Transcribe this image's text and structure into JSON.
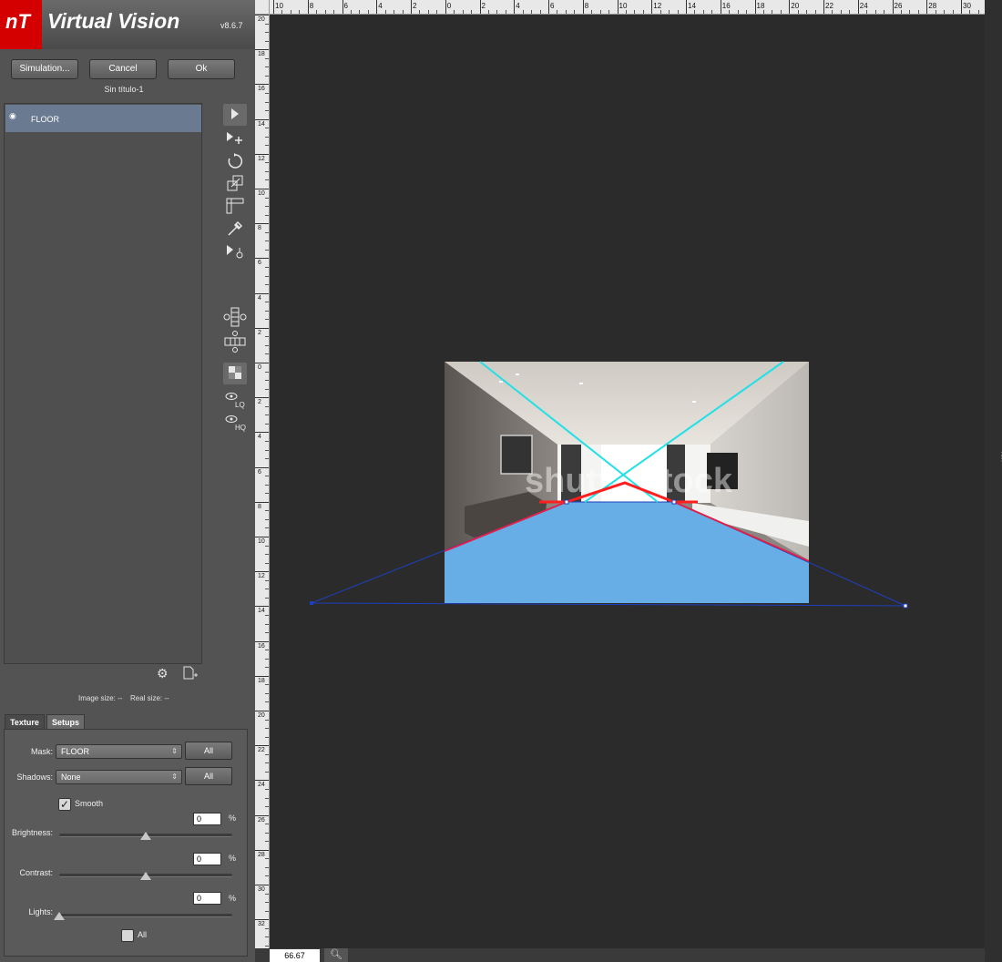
{
  "app": {
    "logo": "nT",
    "title": "Virtual Vision",
    "version": "v8.6.7"
  },
  "toolbar": {
    "simulation_label": "Simulation...",
    "cancel_label": "Cancel",
    "ok_label": "Ok"
  },
  "document": {
    "title": "Sin título-1"
  },
  "layers": [
    {
      "name": "FLOOR",
      "visible": true
    }
  ],
  "info": {
    "image_size": "Image size:  --",
    "real_size": "Real size:  --"
  },
  "tabs": {
    "texture": "Texture",
    "setups": "Setups"
  },
  "setups": {
    "mask_label": "Mask:",
    "mask_value": "FLOOR",
    "shadows_label": "Shadows:",
    "shadows_value": "None",
    "all_label": "All",
    "smooth_label": "Smooth",
    "smooth_checked": true,
    "brightness_label": "Brightness:",
    "brightness_value": "0",
    "contrast_label": "Contrast:",
    "contrast_value": "0",
    "lights_label": "Lights:",
    "lights_value": "0",
    "percent": "%",
    "lights_all_label": "All"
  },
  "ruler_top": [
    "10",
    "8",
    "6",
    "4",
    "2",
    "0",
    "2",
    "4",
    "6",
    "8",
    "10",
    "12",
    "14",
    "16",
    "18",
    "20",
    "22",
    "24",
    "26",
    "28",
    "30"
  ],
  "ruler_left": [
    "20",
    "18",
    "16",
    "14",
    "12",
    "10",
    "8",
    "6",
    "4",
    "2",
    "0",
    "2",
    "4",
    "6",
    "8",
    "10",
    "12",
    "14",
    "16",
    "18",
    "20",
    "22",
    "24",
    "26",
    "28",
    "30",
    "32"
  ],
  "status": {
    "zoom": "66.67"
  },
  "photo": {
    "watermark": "shutterstock"
  },
  "colors": {
    "accent": "#d40000",
    "floor_mask": "#67aee6",
    "perspective_lines": "#22e0e6",
    "edge_lines": "#ff1f1f"
  }
}
